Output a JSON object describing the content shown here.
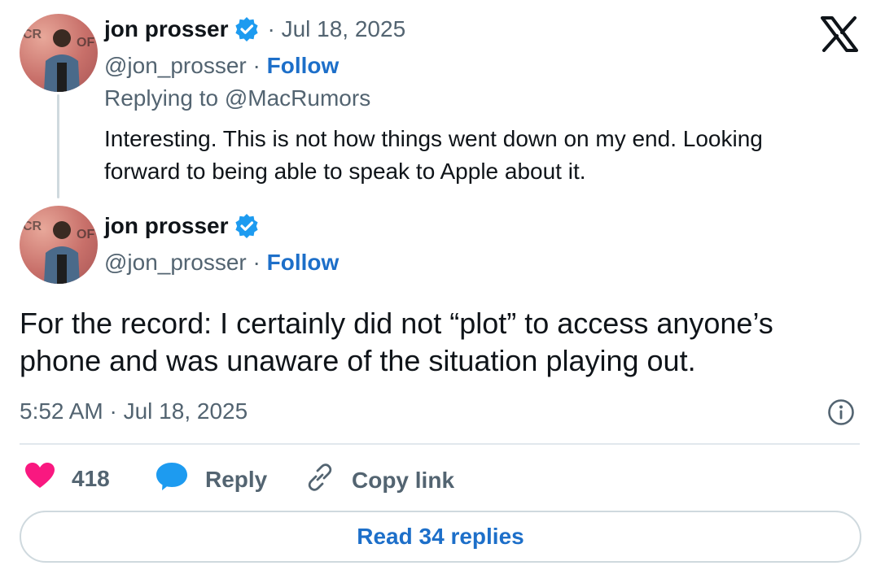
{
  "reply_tweet": {
    "author_name": "jon prosser",
    "date": "· Jul 18, 2025",
    "handle": "@jon_prosser",
    "separator": "·",
    "follow_label": "Follow",
    "replying_to": "Replying to @MacRumors",
    "text_line1": "Interesting. This is not how things went down on my end. Looking",
    "text_line2": "forward to being able to speak to Apple about it."
  },
  "main_tweet": {
    "author_name": "jon prosser",
    "handle": "@jon_prosser",
    "separator": "·",
    "follow_label": "Follow",
    "text_line1": "For the record: I certainly did not “plot” to access anyone’s",
    "text_line2": "phone and was unaware of the situation playing out.",
    "timestamp": "5:52 AM · Jul 18, 2025"
  },
  "actions": {
    "like_count": "418",
    "reply_label": "Reply",
    "copy_link_label": "Copy link"
  },
  "footer": {
    "read_replies_label": "Read 34 replies"
  },
  "colors": {
    "accent": "#1d6fc9",
    "verified": "#1d9bf0",
    "like": "#f91880",
    "reply_bubble": "#1d9bf0",
    "muted": "#536471"
  },
  "icons": {
    "brand": "x-logo-icon",
    "verified": "verified-badge-icon",
    "like": "heart-icon",
    "reply": "speech-bubble-icon",
    "copy": "link-icon",
    "info": "info-icon"
  }
}
